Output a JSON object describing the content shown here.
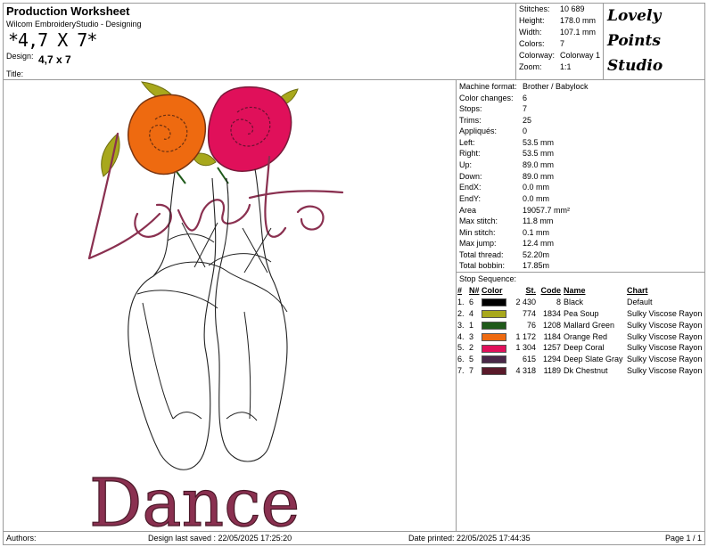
{
  "header": {
    "title": "Production Worksheet",
    "subtitle": "Wilcom EmbroideryStudio - Designing",
    "design_name_large": "*4,7 X 7*",
    "design_label": "Design:",
    "design_value": "4,7 x 7",
    "title_label": "Title:"
  },
  "summary": [
    {
      "label": "Stitches:",
      "value": "10 689"
    },
    {
      "label": "Height:",
      "value": "178.0 mm"
    },
    {
      "label": "Width:",
      "value": "107.1 mm"
    },
    {
      "label": "Colors:",
      "value": "7"
    },
    {
      "label": "Colorway:",
      "value": "Colorway 1"
    },
    {
      "label": "Zoom:",
      "value": "1:1"
    }
  ],
  "logo": {
    "line1": "Lovely",
    "line2": "Points",
    "line3": "Studio"
  },
  "details": [
    {
      "label": "Machine format:",
      "value": "Brother / Babylock"
    },
    {
      "label": "Color changes:",
      "value": "6"
    },
    {
      "label": "Stops:",
      "value": "7"
    },
    {
      "label": "Trims:",
      "value": "25"
    },
    {
      "label": "Appliqués:",
      "value": "0"
    },
    {
      "label": "Left:",
      "value": "53.5 mm"
    },
    {
      "label": "Right:",
      "value": "53.5 mm"
    },
    {
      "label": "Up:",
      "value": "89.0 mm"
    },
    {
      "label": "Down:",
      "value": "89.0 mm"
    },
    {
      "label": "EndX:",
      "value": "0.0 mm"
    },
    {
      "label": "EndY:",
      "value": "0.0 mm"
    },
    {
      "label": "Area",
      "value": "19057.7 mm²"
    },
    {
      "label": "Max stitch:",
      "value": "11.8 mm"
    },
    {
      "label": "Min stitch:",
      "value": "0.1 mm"
    },
    {
      "label": "Max jump:",
      "value": "12.4 mm"
    },
    {
      "label": "Total thread:",
      "value": "52.20m"
    },
    {
      "label": "Total bobbin:",
      "value": "17.85m"
    }
  ],
  "stop_sequence": {
    "heading": "Stop Sequence:",
    "columns": [
      "#",
      "N#",
      "Color",
      "St.",
      "Code",
      "Name",
      "Chart"
    ],
    "rows": [
      {
        "num": "1.",
        "n": "6",
        "color": "#000000",
        "st": "2 430",
        "code": "8",
        "name": "Black",
        "chart": "Default"
      },
      {
        "num": "2.",
        "n": "4",
        "color": "#a8a81c",
        "st": "774",
        "code": "1834",
        "name": "Pea Soup",
        "chart": "Sulky Viscose Rayon"
      },
      {
        "num": "3.",
        "n": "1",
        "color": "#1f5a1a",
        "st": "76",
        "code": "1208",
        "name": "Mallard Green",
        "chart": "Sulky Viscose Rayon"
      },
      {
        "num": "4.",
        "n": "3",
        "color": "#ee6a10",
        "st": "1 172",
        "code": "1184",
        "name": "Orange Red",
        "chart": "Sulky Viscose Rayon"
      },
      {
        "num": "5.",
        "n": "2",
        "color": "#e0105a",
        "st": "1 304",
        "code": "1257",
        "name": "Deep Coral",
        "chart": "Sulky Viscose Rayon"
      },
      {
        "num": "6.",
        "n": "5",
        "color": "#4a2848",
        "st": "615",
        "code": "1294",
        "name": "Deep Slate Gray",
        "chart": "Sulky Viscose Rayon"
      },
      {
        "num": "7.",
        "n": "7",
        "color": "#5a1a2a",
        "st": "4 318",
        "code": "1189",
        "name": "Dk Chestnut",
        "chart": "Sulky Viscose Rayon"
      }
    ]
  },
  "design_preview": {
    "text_top": "Love to",
    "text_bottom": "Dance"
  },
  "footer": {
    "authors_label": "Authors:",
    "last_saved": "Design last saved : 22/05/2025 17:25:20",
    "printed": "Date printed: 22/05/2025 17:44:35",
    "page": "Page 1 / 1"
  }
}
